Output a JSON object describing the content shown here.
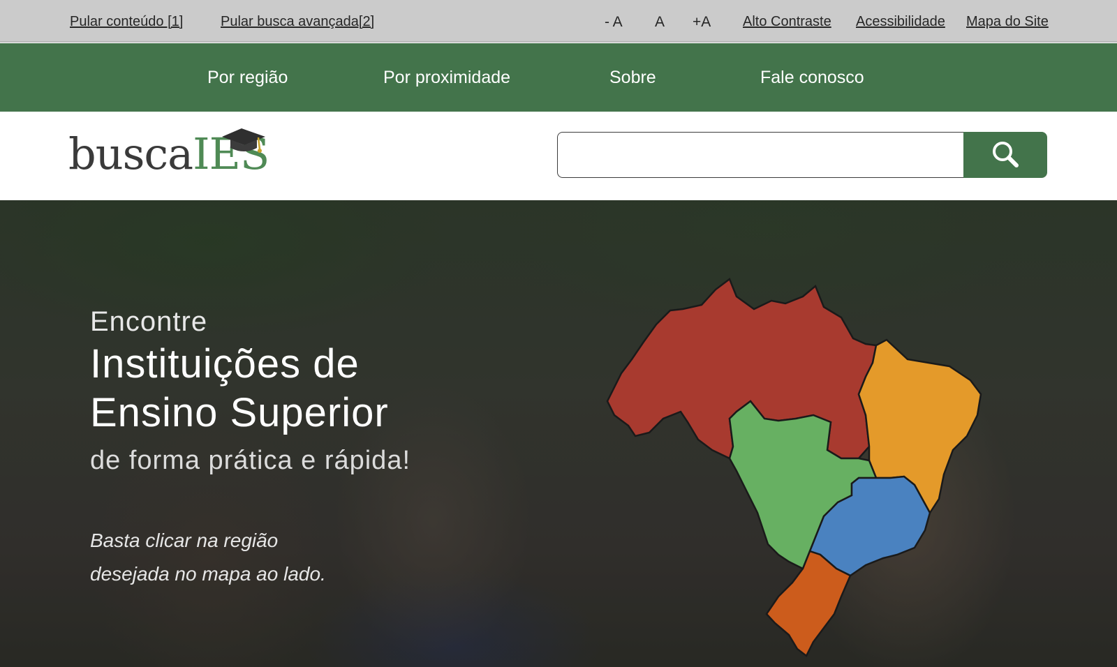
{
  "accessibility_bar": {
    "skip_content": "Pular conteúdo [1]",
    "skip_search": "Pular busca avançada[2]",
    "font_decrease": "- A",
    "font_reset": "A",
    "font_increase": "+A",
    "high_contrast": "Alto Contraste",
    "accessibility": "Acessibilidade",
    "sitemap": "Mapa do Site"
  },
  "nav": {
    "items": [
      {
        "label": "Por região"
      },
      {
        "label": "Por proximidade"
      },
      {
        "label": "Sobre"
      },
      {
        "label": "Fale conosco"
      }
    ]
  },
  "header": {
    "logo": {
      "part1": "busca",
      "part2": "IES"
    },
    "search": {
      "placeholder": "",
      "value": ""
    }
  },
  "hero": {
    "kicker": "Encontre",
    "title_line1": "Instituições de",
    "title_line2": "Ensino Superior",
    "subtitle": "de forma prática e rápida!",
    "hint_line1": "Basta clicar na região",
    "hint_line2": "desejada no mapa ao lado."
  },
  "map": {
    "regions": [
      {
        "id": "norte",
        "color": "#a83a2f"
      },
      {
        "id": "nordeste",
        "color": "#e49a2a"
      },
      {
        "id": "centro-oeste",
        "color": "#67b062"
      },
      {
        "id": "sudeste",
        "color": "#4a82c0"
      },
      {
        "id": "sul",
        "color": "#cc5c1c"
      }
    ]
  },
  "colors": {
    "brand_green": "#43744b",
    "topbar_bg": "#cbcbcb"
  }
}
